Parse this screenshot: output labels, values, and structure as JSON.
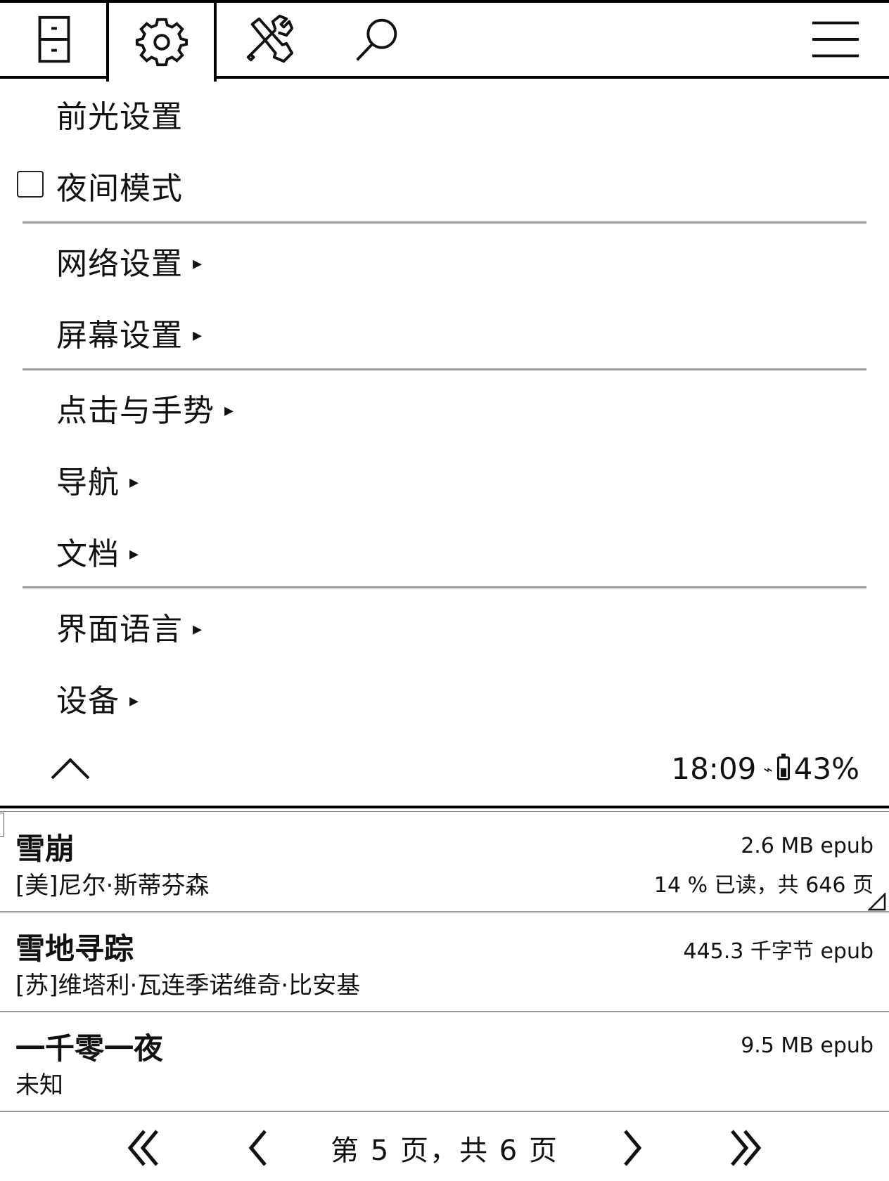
{
  "tabs": [
    {
      "name": "file-browser-icon"
    },
    {
      "name": "gear-icon"
    },
    {
      "name": "tools-icon"
    },
    {
      "name": "search-icon"
    }
  ],
  "menu": {
    "frontlight": "前光设置",
    "night_mode": "夜间模式",
    "network": "网络设置",
    "screen": "屏幕设置",
    "taps_gestures": "点击与手势",
    "navigation": "导航",
    "document": "文档",
    "language": "界面语言",
    "device": "设备",
    "submenu_arrow": "▸"
  },
  "status": {
    "time": "18:09",
    "wifi": "⌁",
    "battery": "43%",
    "battery_level": 0.43
  },
  "books": [
    {
      "title": "雪崩",
      "author": "[美]尼尔·斯蒂芬森",
      "meta": "2.6 MB  epub",
      "progress": "14 % 已读，共 646 页"
    },
    {
      "title": "雪地寻踪",
      "author": "[苏]维塔利·瓦连季诺维奇·比安基",
      "meta": "445.3 千字节  epub",
      "progress": ""
    },
    {
      "title": "一千零一夜",
      "author": "未知",
      "meta": "9.5 MB  epub",
      "progress": ""
    }
  ],
  "pager": {
    "label": "第 5 页，共 6 页"
  }
}
